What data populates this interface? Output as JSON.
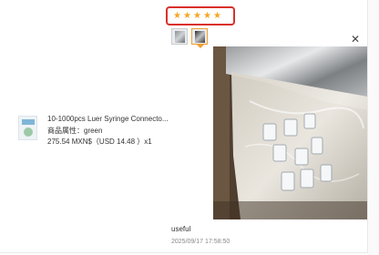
{
  "rating": {
    "stars": 5,
    "max": 5,
    "star_glyph": "★",
    "star_color": "#f5a623",
    "highlight_color": "#d9302b"
  },
  "thumbnails": [
    {
      "label": "photo-1",
      "selected": false
    },
    {
      "label": "photo-2",
      "selected": true
    }
  ],
  "viewer": {
    "close_glyph": "✕"
  },
  "product": {
    "title": "10-1000pcs Luer Syringe Connecto...",
    "attribute": "商品属性：green",
    "price": "275.54 MXN$（USD  14.48 ）x1"
  },
  "review": {
    "text": "useful",
    "date": "2025/09/17 17:58:50"
  }
}
